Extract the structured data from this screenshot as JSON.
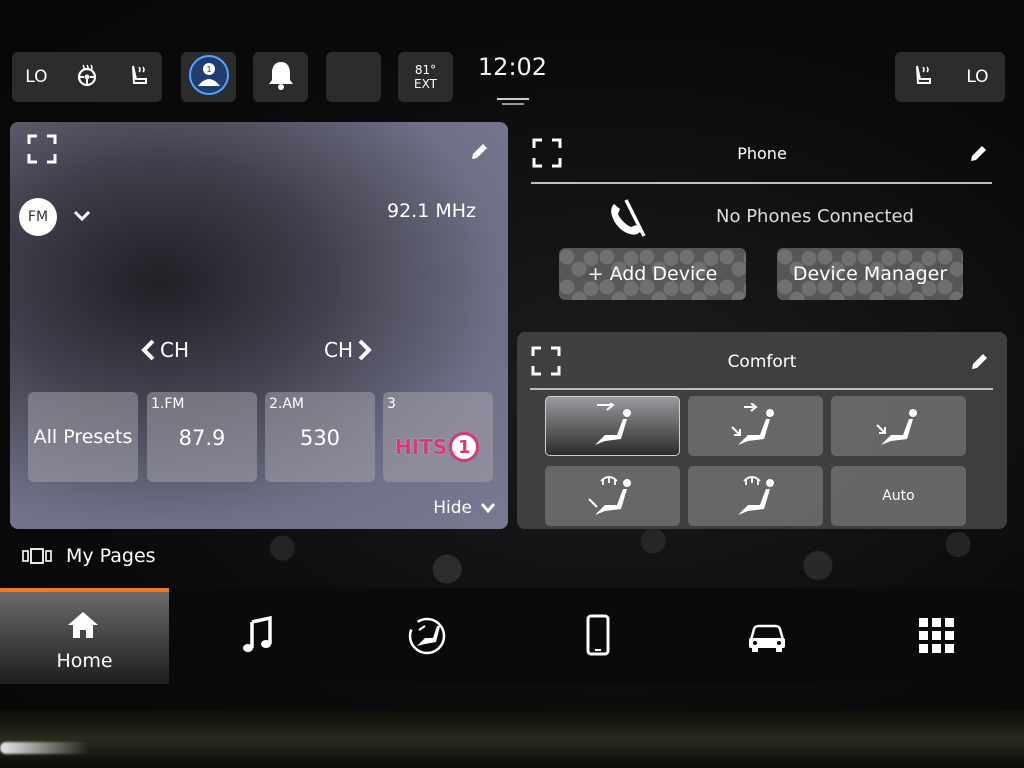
{
  "top_bar": {
    "left_climate": {
      "label": "LO",
      "heated_steering_icon": "heated-steering-icon",
      "heated_seat_icon": "heated-seat-icon"
    },
    "driver_icon": "driver-profile-icon",
    "bell_icon": "bell-icon",
    "temperature": {
      "value": "81°",
      "label": "EXT"
    },
    "clock": "12:02",
    "right_climate": {
      "label": "LO",
      "heated_seat_icon": "heated-seat-icon"
    }
  },
  "radio": {
    "band": "FM",
    "frequency": "92.1 MHz",
    "ch_prev": "CH",
    "ch_next": "CH",
    "presets": [
      {
        "num": "",
        "label": "All Presets"
      },
      {
        "num": "1.FM",
        "label": "87.9"
      },
      {
        "num": "2.AM",
        "label": "530"
      },
      {
        "num": "3",
        "label": "HITS",
        "logo_digit": "1"
      }
    ],
    "hide": "Hide"
  },
  "phone": {
    "title": "Phone",
    "status": "No Phones Connected",
    "add_device": "+ Add Device",
    "device_manager": "Device Manager"
  },
  "comfort": {
    "title": "Comfort",
    "auto": "Auto"
  },
  "my_pages": "My Pages",
  "nav": {
    "home": "Home"
  },
  "colors": {
    "accent": "#f07a1a",
    "hits_logo": "#d6397a"
  }
}
